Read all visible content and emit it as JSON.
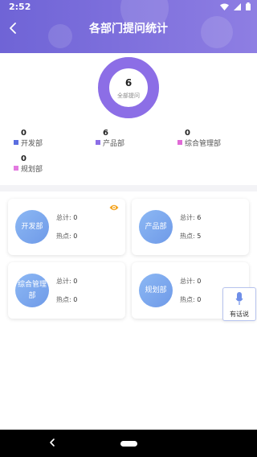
{
  "status_bar": {
    "time": "2:52"
  },
  "header": {
    "title": "各部门提问统计"
  },
  "summary": {
    "total": "6",
    "total_label": "全部提问",
    "colors": {
      "ring": "#8c6ee6",
      "ring_track": "#e6e0f8"
    }
  },
  "legend": [
    {
      "count": "0",
      "name": "开发部",
      "color": "#5b6ee0"
    },
    {
      "count": "6",
      "name": "产品部",
      "color": "#8c6ee6"
    },
    {
      "count": "0",
      "name": "综合管理部",
      "color": "#e06ad6"
    },
    {
      "count": "0",
      "name": "规划部",
      "color": "#e37ae0"
    }
  ],
  "cards": [
    {
      "dept": "开发部",
      "total_label": "总计: ",
      "total": "0",
      "hot_label": "热点: ",
      "hot": "0"
    },
    {
      "dept": "产品部",
      "total_label": "总计: ",
      "total": "6",
      "hot_label": "热点: ",
      "hot": "5"
    },
    {
      "dept": "综合管理部",
      "total_label": "总计: ",
      "total": "0",
      "hot_label": "热点: ",
      "hot": "0"
    },
    {
      "dept": "规划部",
      "total_label": "总计: ",
      "total": "0",
      "hot_label": "热点: ",
      "hot": "0"
    }
  ],
  "float_button": {
    "label": "有话说"
  },
  "icons": {
    "back": "chevron-left-icon",
    "eye": "eye-icon",
    "mic": "microphone-icon",
    "wifi": "wifi-icon",
    "signal": "signal-icon",
    "battery": "battery-icon"
  },
  "accent": {
    "eye": "#f5a623",
    "card_circle": "#7fa8ee",
    "header": "#7668da"
  }
}
